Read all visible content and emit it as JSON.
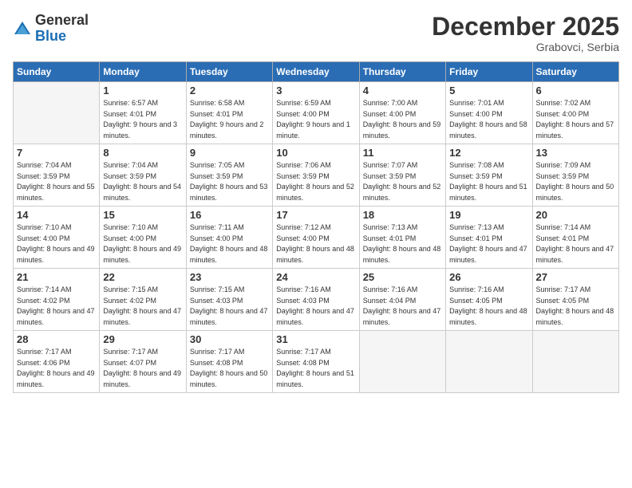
{
  "header": {
    "logo_general": "General",
    "logo_blue": "Blue",
    "title": "December 2025",
    "location": "Grabovci, Serbia"
  },
  "calendar": {
    "days_of_week": [
      "Sunday",
      "Monday",
      "Tuesday",
      "Wednesday",
      "Thursday",
      "Friday",
      "Saturday"
    ],
    "weeks": [
      [
        {
          "day": "",
          "sunrise": "",
          "sunset": "",
          "daylight": "",
          "empty": true
        },
        {
          "day": "1",
          "sunrise": "Sunrise: 6:57 AM",
          "sunset": "Sunset: 4:01 PM",
          "daylight": "Daylight: 9 hours and 3 minutes."
        },
        {
          "day": "2",
          "sunrise": "Sunrise: 6:58 AM",
          "sunset": "Sunset: 4:01 PM",
          "daylight": "Daylight: 9 hours and 2 minutes."
        },
        {
          "day": "3",
          "sunrise": "Sunrise: 6:59 AM",
          "sunset": "Sunset: 4:00 PM",
          "daylight": "Daylight: 9 hours and 1 minute."
        },
        {
          "day": "4",
          "sunrise": "Sunrise: 7:00 AM",
          "sunset": "Sunset: 4:00 PM",
          "daylight": "Daylight: 8 hours and 59 minutes."
        },
        {
          "day": "5",
          "sunrise": "Sunrise: 7:01 AM",
          "sunset": "Sunset: 4:00 PM",
          "daylight": "Daylight: 8 hours and 58 minutes."
        },
        {
          "day": "6",
          "sunrise": "Sunrise: 7:02 AM",
          "sunset": "Sunset: 4:00 PM",
          "daylight": "Daylight: 8 hours and 57 minutes."
        }
      ],
      [
        {
          "day": "7",
          "sunrise": "Sunrise: 7:04 AM",
          "sunset": "Sunset: 3:59 PM",
          "daylight": "Daylight: 8 hours and 55 minutes."
        },
        {
          "day": "8",
          "sunrise": "Sunrise: 7:04 AM",
          "sunset": "Sunset: 3:59 PM",
          "daylight": "Daylight: 8 hours and 54 minutes."
        },
        {
          "day": "9",
          "sunrise": "Sunrise: 7:05 AM",
          "sunset": "Sunset: 3:59 PM",
          "daylight": "Daylight: 8 hours and 53 minutes."
        },
        {
          "day": "10",
          "sunrise": "Sunrise: 7:06 AM",
          "sunset": "Sunset: 3:59 PM",
          "daylight": "Daylight: 8 hours and 52 minutes."
        },
        {
          "day": "11",
          "sunrise": "Sunrise: 7:07 AM",
          "sunset": "Sunset: 3:59 PM",
          "daylight": "Daylight: 8 hours and 52 minutes."
        },
        {
          "day": "12",
          "sunrise": "Sunrise: 7:08 AM",
          "sunset": "Sunset: 3:59 PM",
          "daylight": "Daylight: 8 hours and 51 minutes."
        },
        {
          "day": "13",
          "sunrise": "Sunrise: 7:09 AM",
          "sunset": "Sunset: 3:59 PM",
          "daylight": "Daylight: 8 hours and 50 minutes."
        }
      ],
      [
        {
          "day": "14",
          "sunrise": "Sunrise: 7:10 AM",
          "sunset": "Sunset: 4:00 PM",
          "daylight": "Daylight: 8 hours and 49 minutes."
        },
        {
          "day": "15",
          "sunrise": "Sunrise: 7:10 AM",
          "sunset": "Sunset: 4:00 PM",
          "daylight": "Daylight: 8 hours and 49 minutes."
        },
        {
          "day": "16",
          "sunrise": "Sunrise: 7:11 AM",
          "sunset": "Sunset: 4:00 PM",
          "daylight": "Daylight: 8 hours and 48 minutes."
        },
        {
          "day": "17",
          "sunrise": "Sunrise: 7:12 AM",
          "sunset": "Sunset: 4:00 PM",
          "daylight": "Daylight: 8 hours and 48 minutes."
        },
        {
          "day": "18",
          "sunrise": "Sunrise: 7:13 AM",
          "sunset": "Sunset: 4:01 PM",
          "daylight": "Daylight: 8 hours and 48 minutes."
        },
        {
          "day": "19",
          "sunrise": "Sunrise: 7:13 AM",
          "sunset": "Sunset: 4:01 PM",
          "daylight": "Daylight: 8 hours and 47 minutes."
        },
        {
          "day": "20",
          "sunrise": "Sunrise: 7:14 AM",
          "sunset": "Sunset: 4:01 PM",
          "daylight": "Daylight: 8 hours and 47 minutes."
        }
      ],
      [
        {
          "day": "21",
          "sunrise": "Sunrise: 7:14 AM",
          "sunset": "Sunset: 4:02 PM",
          "daylight": "Daylight: 8 hours and 47 minutes."
        },
        {
          "day": "22",
          "sunrise": "Sunrise: 7:15 AM",
          "sunset": "Sunset: 4:02 PM",
          "daylight": "Daylight: 8 hours and 47 minutes."
        },
        {
          "day": "23",
          "sunrise": "Sunrise: 7:15 AM",
          "sunset": "Sunset: 4:03 PM",
          "daylight": "Daylight: 8 hours and 47 minutes."
        },
        {
          "day": "24",
          "sunrise": "Sunrise: 7:16 AM",
          "sunset": "Sunset: 4:03 PM",
          "daylight": "Daylight: 8 hours and 47 minutes."
        },
        {
          "day": "25",
          "sunrise": "Sunrise: 7:16 AM",
          "sunset": "Sunset: 4:04 PM",
          "daylight": "Daylight: 8 hours and 47 minutes."
        },
        {
          "day": "26",
          "sunrise": "Sunrise: 7:16 AM",
          "sunset": "Sunset: 4:05 PM",
          "daylight": "Daylight: 8 hours and 48 minutes."
        },
        {
          "day": "27",
          "sunrise": "Sunrise: 7:17 AM",
          "sunset": "Sunset: 4:05 PM",
          "daylight": "Daylight: 8 hours and 48 minutes."
        }
      ],
      [
        {
          "day": "28",
          "sunrise": "Sunrise: 7:17 AM",
          "sunset": "Sunset: 4:06 PM",
          "daylight": "Daylight: 8 hours and 49 minutes."
        },
        {
          "day": "29",
          "sunrise": "Sunrise: 7:17 AM",
          "sunset": "Sunset: 4:07 PM",
          "daylight": "Daylight: 8 hours and 49 minutes."
        },
        {
          "day": "30",
          "sunrise": "Sunrise: 7:17 AM",
          "sunset": "Sunset: 4:08 PM",
          "daylight": "Daylight: 8 hours and 50 minutes."
        },
        {
          "day": "31",
          "sunrise": "Sunrise: 7:17 AM",
          "sunset": "Sunset: 4:08 PM",
          "daylight": "Daylight: 8 hours and 51 minutes."
        },
        {
          "day": "",
          "sunrise": "",
          "sunset": "",
          "daylight": "",
          "empty": true
        },
        {
          "day": "",
          "sunrise": "",
          "sunset": "",
          "daylight": "",
          "empty": true
        },
        {
          "day": "",
          "sunrise": "",
          "sunset": "",
          "daylight": "",
          "empty": true
        }
      ]
    ]
  }
}
